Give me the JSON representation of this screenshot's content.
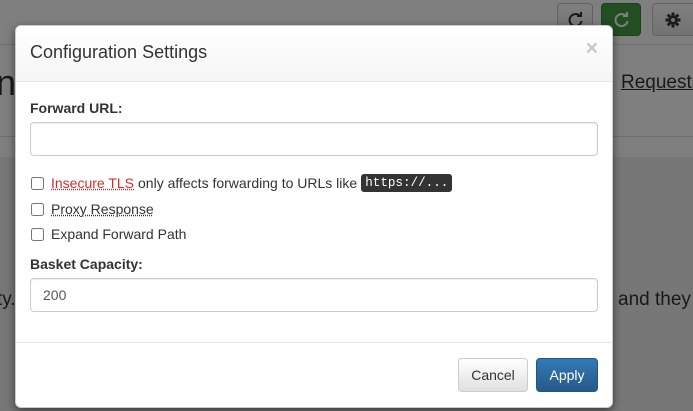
{
  "background": {
    "title_fragment": "n",
    "tab_label": "Requests",
    "text_left": "ty.",
    "text_right": "and they"
  },
  "toolbar": {
    "refresh_icon": "refresh-icon",
    "auto_refresh_icon": "auto-refresh-icon",
    "settings_icon": "gear-icon"
  },
  "modal": {
    "title": "Configuration Settings",
    "close_symbol": "×",
    "forward_url": {
      "label": "Forward URL:",
      "value": "",
      "placeholder": ""
    },
    "checkboxes": {
      "insecure_tls": {
        "link_text": "Insecure TLS",
        "suffix_text": "only affects forwarding to URLs like",
        "code_sample": "https://...",
        "checked": false
      },
      "proxy_response": {
        "label": "Proxy Response",
        "checked": false
      },
      "expand_forward_path": {
        "label": "Expand Forward Path",
        "checked": false
      }
    },
    "basket_capacity": {
      "label": "Basket Capacity:",
      "value": "200"
    },
    "buttons": {
      "cancel": "Cancel",
      "apply": "Apply"
    }
  },
  "colors": {
    "primary": "#337ab7",
    "success": "#449d44",
    "danger_text": "#c9302c",
    "code_bg": "#333333"
  }
}
